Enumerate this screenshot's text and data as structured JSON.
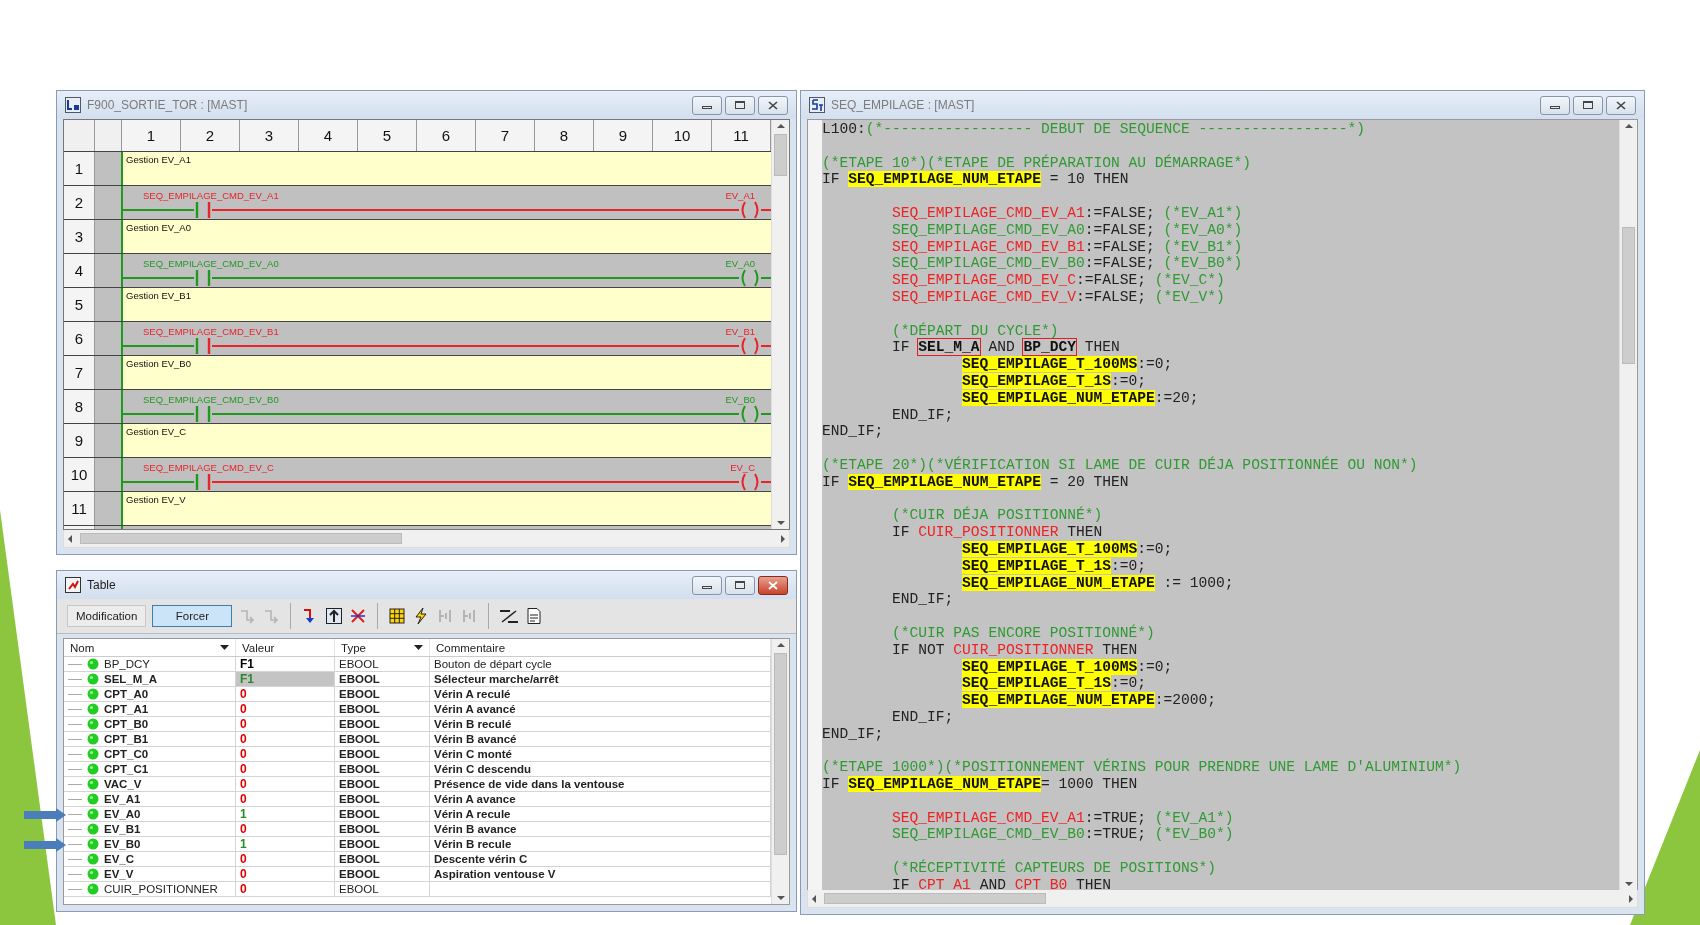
{
  "ladder_window": {
    "title": "F900_SORTIE_TOR : [MAST]",
    "columns": [
      "1",
      "2",
      "3",
      "4",
      "5",
      "6",
      "7",
      "8",
      "9",
      "10",
      "11"
    ],
    "rows": [
      {
        "kind": "comment",
        "number": "1",
        "text": "Gestion EV_A1"
      },
      {
        "kind": "rung",
        "number": "2",
        "contact": "SEQ_EMPILAGE_CMD_EV_A1",
        "coil": "EV_A1",
        "energized": false
      },
      {
        "kind": "comment",
        "number": "3",
        "text": "Gestion EV_A0"
      },
      {
        "kind": "rung",
        "number": "4",
        "contact": "SEQ_EMPILAGE_CMD_EV_A0",
        "coil": "EV_A0",
        "energized": true
      },
      {
        "kind": "comment",
        "number": "5",
        "text": "Gestion EV_B1"
      },
      {
        "kind": "rung",
        "number": "6",
        "contact": "SEQ_EMPILAGE_CMD_EV_B1",
        "coil": "EV_B1",
        "energized": false
      },
      {
        "kind": "comment",
        "number": "7",
        "text": "Gestion EV_B0"
      },
      {
        "kind": "rung",
        "number": "8",
        "contact": "SEQ_EMPILAGE_CMD_EV_B0",
        "coil": "EV_B0",
        "energized": true
      },
      {
        "kind": "comment",
        "number": "9",
        "text": "Gestion EV_C"
      },
      {
        "kind": "rung",
        "number": "10",
        "contact": "SEQ_EMPILAGE_CMD_EV_C",
        "coil": "EV_C",
        "energized": false
      },
      {
        "kind": "comment",
        "number": "11",
        "text": "Gestion EV_V"
      }
    ]
  },
  "table_window": {
    "title": "Table",
    "buttons": [
      {
        "label": "Modification",
        "selected": false
      },
      {
        "label": "Forcer",
        "selected": true
      }
    ],
    "tools": [
      {
        "kind": "step",
        "disabled": true
      },
      {
        "kind": "step",
        "disabled": true
      },
      {
        "kind": "separator"
      },
      {
        "kind": "arrow_down",
        "disabled": false
      },
      {
        "kind": "arrow_up",
        "disabled": false
      },
      {
        "kind": "cross",
        "disabled": false
      },
      {
        "kind": "separator"
      },
      {
        "kind": "grid",
        "disabled": false
      },
      {
        "kind": "lightning",
        "disabled": false
      },
      {
        "kind": "bracket",
        "disabled": true
      },
      {
        "kind": "bracket",
        "disabled": true
      },
      {
        "kind": "separator"
      },
      {
        "kind": "slash",
        "disabled": false
      },
      {
        "kind": "document",
        "disabled": false
      }
    ],
    "columns": [
      {
        "label": "Nom",
        "dropdown": true
      },
      {
        "label": "Valeur",
        "dropdown": false
      },
      {
        "label": "Type",
        "dropdown": true
      },
      {
        "label": "Commentaire",
        "dropdown": false
      }
    ],
    "rows": [
      {
        "name": "BP_DCY",
        "value": "F1",
        "type": "EBOOL",
        "comment": "Bouton de départ cycle",
        "active": false,
        "forced": false,
        "color": "#000000",
        "marked": false
      },
      {
        "name": "SEL_M_A",
        "value": "F1",
        "type": "EBOOL",
        "comment": "Sélecteur marche/arrêt",
        "active": true,
        "forced": true,
        "color": "#2a8a2a",
        "marked": false
      },
      {
        "name": "CPT_A0",
        "value": "0",
        "type": "EBOOL",
        "comment": "Vérin A reculé",
        "active": true,
        "forced": false,
        "color": "#e00000",
        "marked": false
      },
      {
        "name": "CPT_A1",
        "value": "0",
        "type": "EBOOL",
        "comment": "Vérin A avancé",
        "active": true,
        "forced": false,
        "color": "#e00000",
        "marked": false
      },
      {
        "name": "CPT_B0",
        "value": "0",
        "type": "EBOOL",
        "comment": "Vérin B reculé",
        "active": true,
        "forced": false,
        "color": "#e00000",
        "marked": false
      },
      {
        "name": "CPT_B1",
        "value": "0",
        "type": "EBOOL",
        "comment": "Vérin B avancé",
        "active": true,
        "forced": false,
        "color": "#e00000",
        "marked": false
      },
      {
        "name": "CPT_C0",
        "value": "0",
        "type": "EBOOL",
        "comment": "Vérin C monté",
        "active": true,
        "forced": false,
        "color": "#e00000",
        "marked": false
      },
      {
        "name": "CPT_C1",
        "value": "0",
        "type": "EBOOL",
        "comment": "Vérin C descendu",
        "active": true,
        "forced": false,
        "color": "#e00000",
        "marked": false
      },
      {
        "name": "VAC_V",
        "value": "0",
        "type": "EBOOL",
        "comment": "Présence de vide dans la ventouse",
        "active": true,
        "forced": false,
        "color": "#e00000",
        "marked": false
      },
      {
        "name": "EV_A1",
        "value": "0",
        "type": "EBOOL",
        "comment": "Vérin A avance",
        "active": true,
        "forced": false,
        "color": "#e00000",
        "marked": false
      },
      {
        "name": "EV_A0",
        "value": "1",
        "type": "EBOOL",
        "comment": "Vérin A recule",
        "active": true,
        "forced": false,
        "color": "#2a8a2a",
        "marked": true
      },
      {
        "name": "EV_B1",
        "value": "0",
        "type": "EBOOL",
        "comment": "Vérin B avance",
        "active": true,
        "forced": false,
        "color": "#e00000",
        "marked": false
      },
      {
        "name": "EV_B0",
        "value": "1",
        "type": "EBOOL",
        "comment": "Vérin B recule",
        "active": true,
        "forced": false,
        "color": "#2a8a2a",
        "marked": true
      },
      {
        "name": "EV_C",
        "value": "0",
        "type": "EBOOL",
        "comment": "Descente vérin C",
        "active": true,
        "forced": false,
        "color": "#e00000",
        "marked": false
      },
      {
        "name": "EV_V",
        "value": "0",
        "type": "EBOOL",
        "comment": "Aspiration ventouse V",
        "active": true,
        "forced": false,
        "color": "#e00000",
        "marked": false
      },
      {
        "name": "CUIR_POSITIONNER",
        "value": "0",
        "type": "EBOOL",
        "active": false,
        "forced": false,
        "color": "#e00000",
        "marked": false
      }
    ]
  },
  "code_window": {
    "title": "SEQ_EMPILAGE : [MAST]",
    "lines": [
      {
        "kind": "top",
        "segments": [
          {
            "kind": "plain",
            "text": "L100:"
          },
          {
            "kind": "comment",
            "text": "(*----------------- DEBUT DE SEQUENCE -----------------*)"
          }
        ]
      },
      {
        "kind": "blank"
      },
      {
        "kind": "top",
        "segments": [
          {
            "kind": "comment",
            "text": "(*ETAPE 10*)(*ETAPE DE PRÉPARATION AU DÉMARRAGE*)"
          }
        ]
      },
      {
        "kind": "top",
        "segments": [
          {
            "kind": "plain",
            "text": "IF "
          },
          {
            "kind": "mark",
            "text": "SEQ_EMPILAGE_NUM_ETAPE"
          },
          {
            "kind": "plain",
            "text": " = 10 THEN"
          }
        ]
      },
      {
        "kind": "blank"
      },
      {
        "kind": "block",
        "segments": [
          {
            "kind": "red",
            "text": "SEQ_EMPILAGE_CMD_EV_A1"
          },
          {
            "kind": "plain",
            "text": ":=FALSE; "
          },
          {
            "kind": "comment",
            "text": "(*EV_A1*)"
          }
        ]
      },
      {
        "kind": "block",
        "segments": [
          {
            "kind": "green",
            "text": "SEQ_EMPILAGE_CMD_EV_A0"
          },
          {
            "kind": "plain",
            "text": ":=FALSE; "
          },
          {
            "kind": "comment",
            "text": "(*EV_A0*)"
          }
        ]
      },
      {
        "kind": "block",
        "segments": [
          {
            "kind": "red",
            "text": "SEQ_EMPILAGE_CMD_EV_B1"
          },
          {
            "kind": "plain",
            "text": ":=FALSE; "
          },
          {
            "kind": "comment",
            "text": "(*EV_B1*)"
          }
        ]
      },
      {
        "kind": "block",
        "segments": [
          {
            "kind": "green",
            "text": "SEQ_EMPILAGE_CMD_EV_B0"
          },
          {
            "kind": "plain",
            "text": ":=FALSE; "
          },
          {
            "kind": "comment",
            "text": "(*EV_B0*)"
          }
        ]
      },
      {
        "kind": "block",
        "segments": [
          {
            "kind": "red",
            "text": "SEQ_EMPILAGE_CMD_EV_C"
          },
          {
            "kind": "plain",
            "text": ":=FALSE; "
          },
          {
            "kind": "comment",
            "text": "(*EV_C*)"
          }
        ]
      },
      {
        "kind": "block",
        "segments": [
          {
            "kind": "red",
            "text": "SEQ_EMPILAGE_CMD_EV_V"
          },
          {
            "kind": "plain",
            "text": ":=FALSE; "
          },
          {
            "kind": "comment",
            "text": "(*EV_V*)"
          }
        ]
      },
      {
        "kind": "blank"
      },
      {
        "kind": "block",
        "segments": [
          {
            "kind": "comment",
            "text": "(*DÉPART DU CYCLE*)"
          }
        ]
      },
      {
        "kind": "block",
        "segments": [
          {
            "kind": "plain",
            "text": "IF "
          },
          {
            "kind": "boxed",
            "text": "SEL_M_A"
          },
          {
            "kind": "plain",
            "text": " AND "
          },
          {
            "kind": "boxed",
            "text": "BP_DCY"
          },
          {
            "kind": "plain",
            "text": " THEN"
          }
        ]
      },
      {
        "kind": "nested",
        "segments": [
          {
            "kind": "mark",
            "text": "SEQ_EMPILAGE_T_100MS"
          },
          {
            "kind": "plain",
            "text": ":=0;"
          }
        ]
      },
      {
        "kind": "nested",
        "segments": [
          {
            "kind": "mark",
            "text": "SEQ_EMPILAGE_T_1S"
          },
          {
            "kind": "plain",
            "text": ":=0;"
          }
        ]
      },
      {
        "kind": "nested",
        "segments": [
          {
            "kind": "mark",
            "text": "SEQ_EMPILAGE_NUM_ETAPE"
          },
          {
            "kind": "plain",
            "text": ":=20;"
          }
        ]
      },
      {
        "kind": "block",
        "segments": [
          {
            "kind": "plain",
            "text": "END_IF;"
          }
        ]
      },
      {
        "kind": "top",
        "segments": [
          {
            "kind": "plain",
            "text": "END_IF;"
          }
        ]
      },
      {
        "kind": "blank"
      },
      {
        "kind": "top",
        "segments": [
          {
            "kind": "comment",
            "text": "(*ETAPE 20*)(*VÉRIFICATION SI LAME DE CUIR DÉJA POSITIONNÉE OU NON*)"
          }
        ]
      },
      {
        "kind": "top",
        "segments": [
          {
            "kind": "plain",
            "text": "IF "
          },
          {
            "kind": "mark",
            "text": "SEQ_EMPILAGE_NUM_ETAPE"
          },
          {
            "kind": "plain",
            "text": " = 20 THEN"
          }
        ]
      },
      {
        "kind": "blank"
      },
      {
        "kind": "block",
        "segments": [
          {
            "kind": "comment",
            "text": "(*CUIR DÉJA POSITIONNÉ*)"
          }
        ]
      },
      {
        "kind": "block",
        "segments": [
          {
            "kind": "plain",
            "text": "IF "
          },
          {
            "kind": "red",
            "text": "CUIR_POSITIONNER"
          },
          {
            "kind": "plain",
            "text": " THEN"
          }
        ]
      },
      {
        "kind": "nested",
        "segments": [
          {
            "kind": "mark",
            "text": "SEQ_EMPILAGE_T_100MS"
          },
          {
            "kind": "plain",
            "text": ":=0;"
          }
        ]
      },
      {
        "kind": "nested",
        "segments": [
          {
            "kind": "mark",
            "text": "SEQ_EMPILAGE_T_1S"
          },
          {
            "kind": "plain",
            "text": ":=0;"
          }
        ]
      },
      {
        "kind": "nested",
        "segments": [
          {
            "kind": "mark",
            "text": "SEQ_EMPILAGE_NUM_ETAPE"
          },
          {
            "kind": "plain",
            "text": " := 1000;"
          }
        ]
      },
      {
        "kind": "block",
        "segments": [
          {
            "kind": "plain",
            "text": "END_IF;"
          }
        ]
      },
      {
        "kind": "blank"
      },
      {
        "kind": "block",
        "segments": [
          {
            "kind": "comment",
            "text": "(*CUIR PAS ENCORE POSITIONNÉ*)"
          }
        ]
      },
      {
        "kind": "block",
        "segments": [
          {
            "kind": "plain",
            "text": "IF NOT "
          },
          {
            "kind": "red",
            "text": "CUIR_POSITIONNER"
          },
          {
            "kind": "plain",
            "text": " THEN"
          }
        ]
      },
      {
        "kind": "nested",
        "segments": [
          {
            "kind": "mark",
            "text": "SEQ_EMPILAGE_T_100MS"
          },
          {
            "kind": "plain",
            "text": ":=0;"
          }
        ]
      },
      {
        "kind": "nested",
        "segments": [
          {
            "kind": "mark",
            "text": "SEQ_EMPILAGE_T_1S"
          },
          {
            "kind": "plain",
            "text": ":=0;"
          }
        ]
      },
      {
        "kind": "nested",
        "segments": [
          {
            "kind": "mark",
            "text": "SEQ_EMPILAGE_NUM_ETAPE"
          },
          {
            "kind": "plain",
            "text": ":=2000;"
          }
        ]
      },
      {
        "kind": "block",
        "segments": [
          {
            "kind": "plain",
            "text": "END_IF;"
          }
        ]
      },
      {
        "kind": "top",
        "segments": [
          {
            "kind": "plain",
            "text": "END_IF;"
          }
        ]
      },
      {
        "kind": "blank"
      },
      {
        "kind": "top",
        "segments": [
          {
            "kind": "comment",
            "text": "(*ETAPE 1000*)(*POSITIONNEMENT VÉRINS POUR PRENDRE UNE LAME D'ALUMINIUM*)"
          }
        ]
      },
      {
        "kind": "top",
        "segments": [
          {
            "kind": "plain",
            "text": "IF "
          },
          {
            "kind": "mark",
            "text": "SEQ_EMPILAGE_NUM_ETAPE"
          },
          {
            "kind": "plain",
            "text": "= 1000 THEN"
          }
        ]
      },
      {
        "kind": "blank"
      },
      {
        "kind": "block",
        "segments": [
          {
            "kind": "red",
            "text": "SEQ_EMPILAGE_CMD_EV_A1"
          },
          {
            "kind": "plain",
            "text": ":=TRUE; "
          },
          {
            "kind": "comment",
            "text": "(*EV_A1*)"
          }
        ]
      },
      {
        "kind": "block",
        "segments": [
          {
            "kind": "green",
            "text": "SEQ_EMPILAGE_CMD_EV_B0"
          },
          {
            "kind": "plain",
            "text": ":=TRUE; "
          },
          {
            "kind": "comment",
            "text": "(*EV_B0*)"
          }
        ]
      },
      {
        "kind": "blank"
      },
      {
        "kind": "block",
        "segments": [
          {
            "kind": "comment",
            "text": "(*RÉCEPTIVITÉ CAPTEURS DE POSITIONS*)"
          }
        ]
      },
      {
        "kind": "block",
        "segments": [
          {
            "kind": "plain",
            "text": "IF "
          },
          {
            "kind": "red",
            "text": "CPT_A1"
          },
          {
            "kind": "plain",
            "text": " AND "
          },
          {
            "kind": "red",
            "text": "CPT_B0"
          },
          {
            "kind": "plain",
            "text": " THEN"
          }
        ]
      }
    ]
  }
}
